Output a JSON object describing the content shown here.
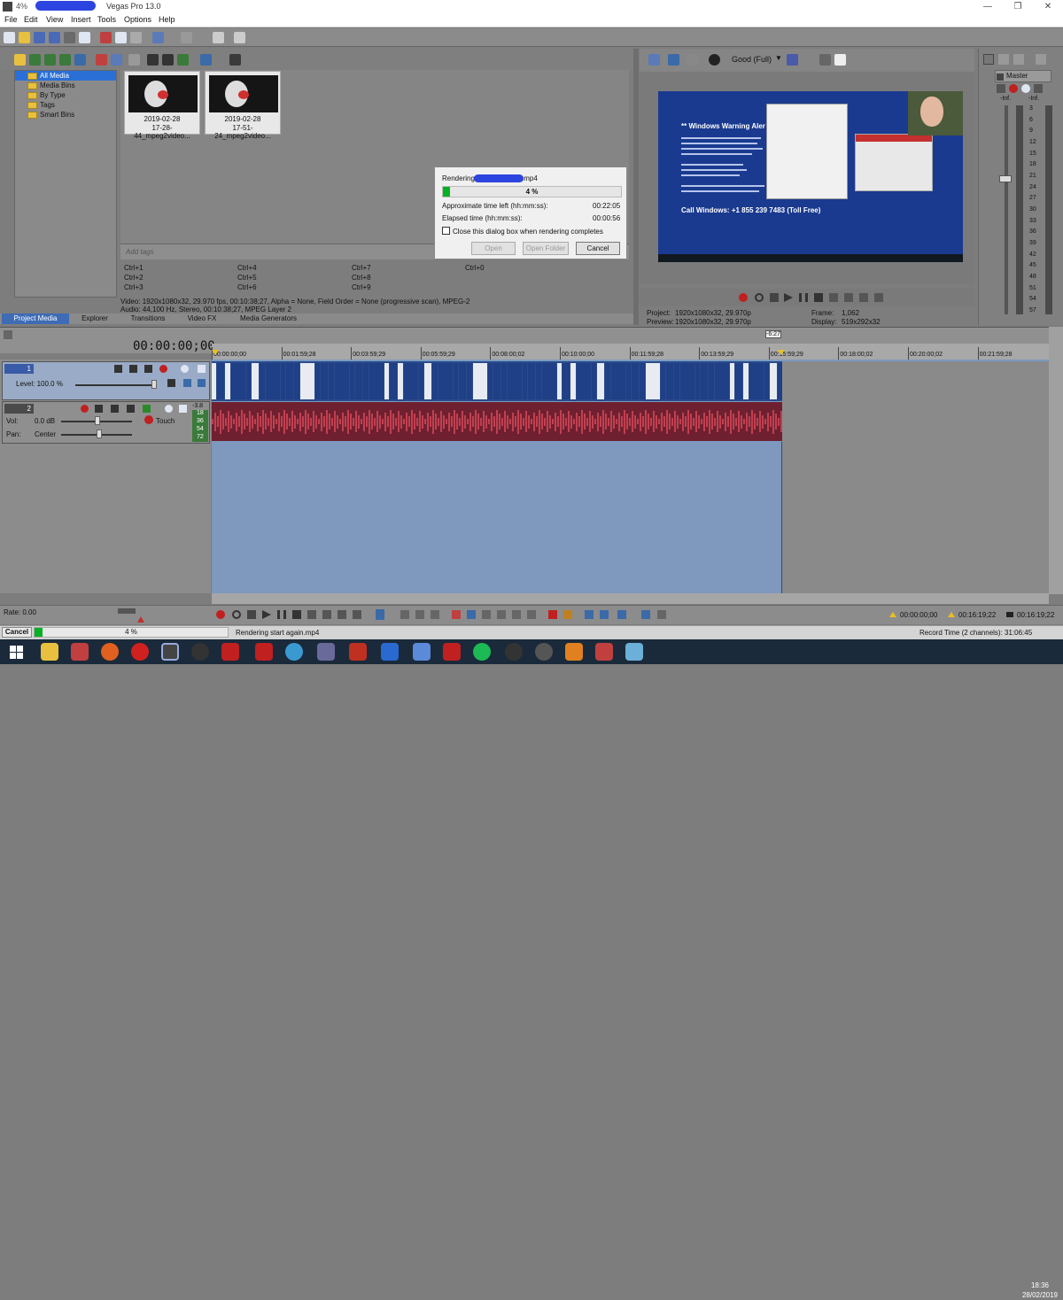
{
  "window": {
    "title_prefix": "4%",
    "app_name": "Vegas Pro 13.0"
  },
  "menu": [
    "File",
    "Edit",
    "View",
    "Insert",
    "Tools",
    "Options",
    "Help"
  ],
  "explorer_tree": [
    "All Media",
    "Media Bins",
    "By Type",
    "Tags",
    "Smart Bins"
  ],
  "media_items": [
    {
      "line1": "2019-02-28",
      "line2": "17-28-44_mpeg2video..."
    },
    {
      "line1": "2019-02-28",
      "line2": "17-51-24_mpeg2video..."
    }
  ],
  "tags": {
    "placeholder": "Add tags"
  },
  "shortcuts": [
    [
      "Ctrl+1",
      "Ctrl+4",
      "Ctrl+7",
      "Ctrl+0"
    ],
    [
      "Ctrl+2",
      "Ctrl+5",
      "Ctrl+8"
    ],
    [
      "Ctrl+3",
      "Ctrl+6",
      "Ctrl+9"
    ]
  ],
  "media_info": {
    "video": "Video: 1920x1080x32, 29.970 fps, 00:10:38;27, Alpha = None, Field Order = None (progressive scan), MPEG-2",
    "audio": "Audio: 44,100 Hz, Stereo, 00:10:38;27, MPEG Layer 2"
  },
  "tabs": [
    "Project Media",
    "Explorer",
    "Transitions",
    "Video FX",
    "Media Generators"
  ],
  "preview": {
    "quality": "Good (Full)",
    "screen_header": "** Windows Warning Aler",
    "screen_footer": "Call Windows: +1 855 239 7483 (Toll Free)",
    "project_label": "Project:",
    "project_value": "1920x1080x32, 29.970p",
    "preview_label": "Preview:",
    "preview_value": "1920x1080x32, 29.970p",
    "frame_label": "Frame:",
    "frame_value": "1,062",
    "display_label": "Display:",
    "display_value": "519x292x32"
  },
  "master": {
    "title": "Master",
    "scale": [
      "3",
      "6",
      "9",
      "12",
      "15",
      "18",
      "21",
      "24",
      "27",
      "30",
      "33",
      "36",
      "39",
      "42",
      "45",
      "48",
      "51",
      "54",
      "57"
    ],
    "inf_left": "-Inf.",
    "inf_right": "-Inf."
  },
  "render_dialog": {
    "title_prefix": "Rendering",
    "title_suffix": ".mp4",
    "progress": 0.04,
    "progress_label": "4 %",
    "time_left_label": "Approximate time left (hh:mm:ss):",
    "time_left_value": "00:22:05",
    "elapsed_label": "Elapsed time (hh:mm:ss):",
    "elapsed_value": "00:00:56",
    "close_checkbox": "Close this dialog box when rendering completes",
    "btn_open": "Open",
    "btn_open_folder": "Open Folder",
    "btn_cancel": "Cancel"
  },
  "timeline": {
    "timecode": "00:00:00;00",
    "marker": "-6:27",
    "ruler": [
      "00:00:00;00",
      "00:01:59;28",
      "00:03:59;29",
      "00:05:59;29",
      "00:08:00;02",
      "00:10:00;00",
      "00:11:59;28",
      "00:13:59;29",
      "00:15:59;29",
      "00:18:00;02",
      "00:20:00;02",
      "00:21:59;28"
    ],
    "video_track": {
      "num": "1",
      "level": "Level: 100.0 %"
    },
    "audio_track": {
      "num": "2",
      "vol_label": "Vol:",
      "vol_value": "0.0 dB",
      "pan_label": "Pan:",
      "pan_value": "Center",
      "mode": "Touch",
      "meter_top": "-3.8",
      "meter_vals": [
        "18",
        "36",
        "54",
        "72"
      ]
    },
    "rate": "Rate: 0.00",
    "tc1": "00:00:00;00",
    "tc2": "00:16:19;22",
    "tc3": "00:16:19;22"
  },
  "status": {
    "cancel": "Cancel",
    "progress": 0.04,
    "progress_label": "4 %",
    "message": "Rendering start again.mp4",
    "record_time": "Record Time (2 channels): 31:06:45"
  },
  "clock": {
    "time": "18:36",
    "date": "28/02/2019"
  },
  "colors": {
    "accent": "#3e6cb5",
    "progress": "#06b025",
    "redact": "#2d45e0"
  }
}
